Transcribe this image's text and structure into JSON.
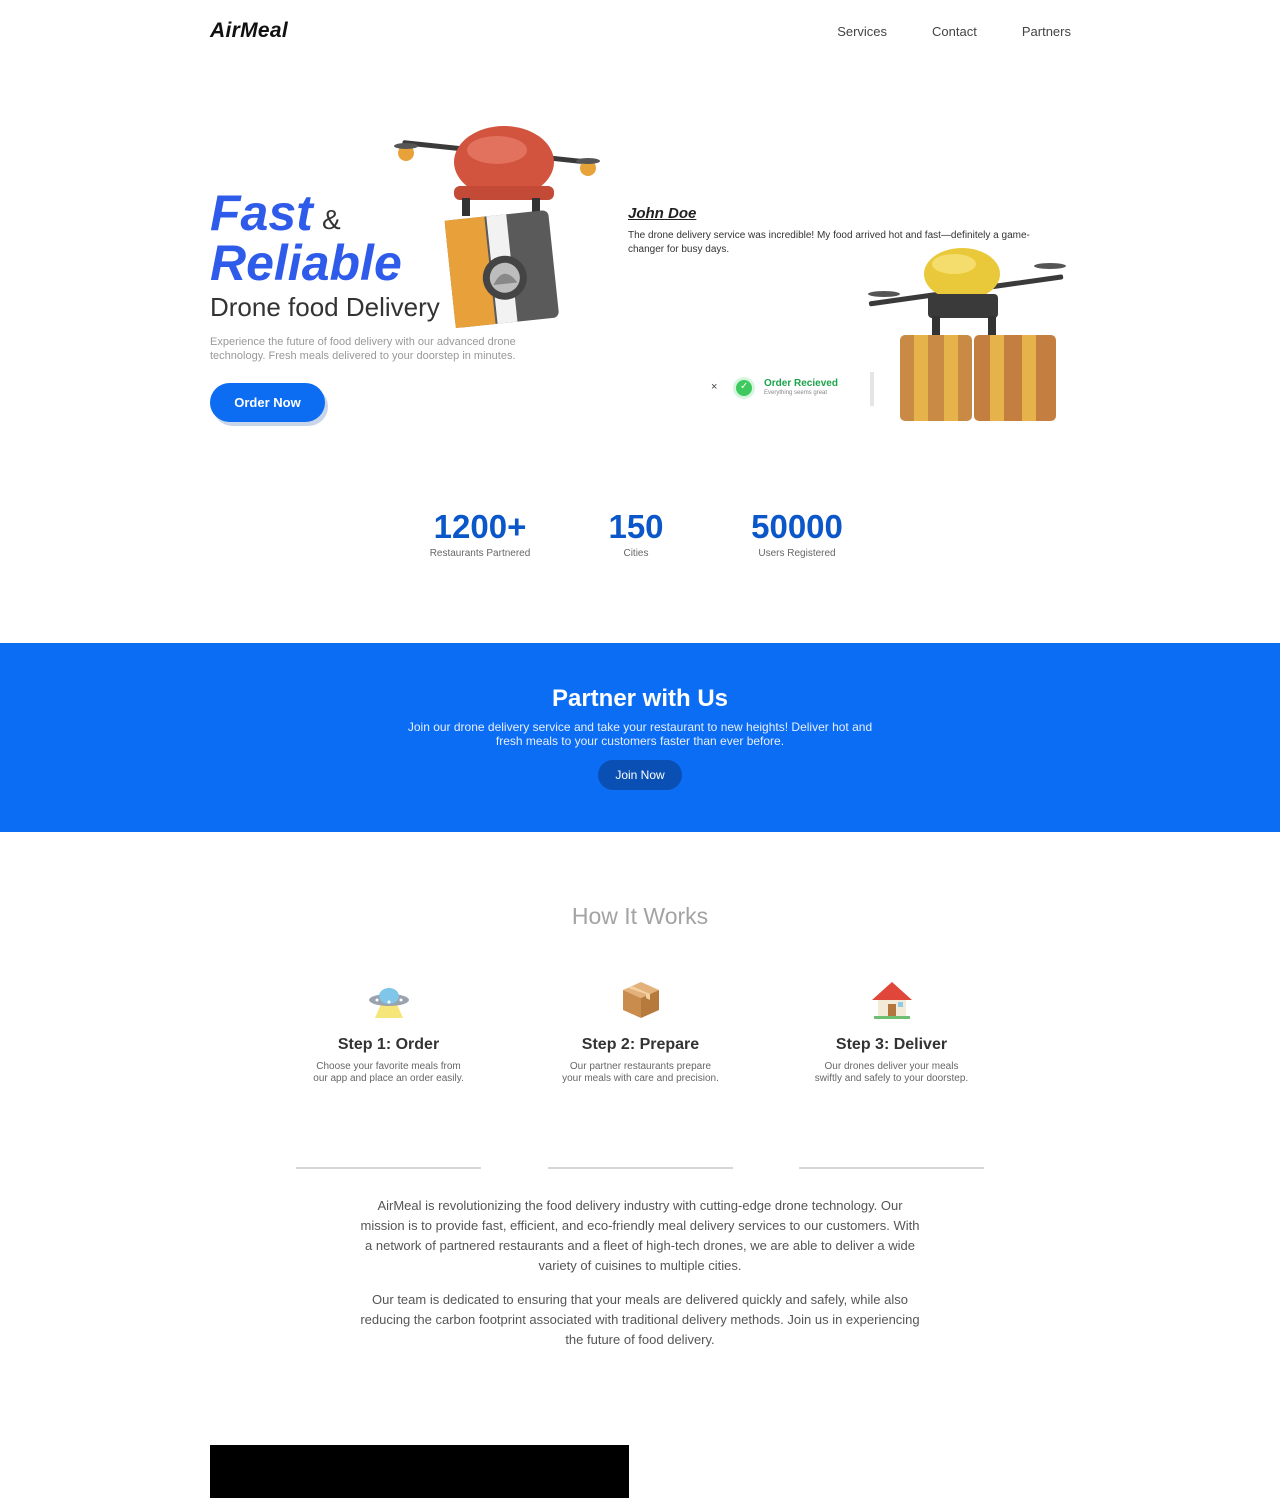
{
  "nav": {
    "logo": "AirMeal",
    "links": [
      "Services",
      "Contact",
      "Partners"
    ]
  },
  "hero": {
    "title_fast": "Fast",
    "title_amp": "&",
    "title_reliable": "Reliable",
    "subtitle": "Drone food Delivery",
    "description": "Experience the future of food delivery with our advanced drone technology. Fresh meals delivered to your doorstep in minutes.",
    "cta": "Order Now"
  },
  "testimonial": {
    "name": "John Doe",
    "text": "The drone delivery service was incredible! My food arrived hot and fast—definitely a game-changer for busy days."
  },
  "toast": {
    "close": "×",
    "title": "Order Recieved",
    "subtitle": "Everything seems great"
  },
  "stats": [
    {
      "value": "1200+",
      "label": "Restaurants Partnered"
    },
    {
      "value": "150",
      "label": "Cities"
    },
    {
      "value": "50000",
      "label": "Users Registered"
    }
  ],
  "partner": {
    "title": "Partner with Us",
    "description": "Join our drone delivery service and take your restaurant to new heights! Deliver hot and fresh meals to your customers faster than ever before.",
    "cta": "Join Now"
  },
  "how": {
    "title": "How It Works",
    "steps": [
      {
        "icon": "ufo-icon",
        "glyph": "🛸",
        "title": "Step 1: Order",
        "desc": "Choose your favorite meals from our app and place an order easily."
      },
      {
        "icon": "package-icon",
        "glyph": "📦",
        "title": "Step 2: Prepare",
        "desc": "Our partner restaurants prepare your meals with care and precision."
      },
      {
        "icon": "house-icon",
        "glyph": "🏠",
        "title": "Step 3: Deliver",
        "desc": "Our drones deliver your meals swiftly and safely to your doorstep."
      }
    ]
  },
  "about": {
    "p1": "AirMeal is revolutionizing the food delivery industry with cutting-edge drone technology. Our mission is to provide fast, efficient, and eco-friendly meal delivery services to our customers. With a network of partnered restaurants and a fleet of high-tech drones, we are able to deliver a wide variety of cuisines to multiple cities.",
    "p2": "Our team is dedicated to ensuring that your meals are delivered quickly and safely, while also reducing the carbon footprint associated with traditional delivery methods. Join us in experiencing the future of food delivery."
  },
  "colors": {
    "accent": "#0c6cf2",
    "hero_title": "#2f5bea",
    "stat_number": "#0b57c9",
    "band": "#0b6cf4",
    "toast_success": "#1aa34a"
  }
}
